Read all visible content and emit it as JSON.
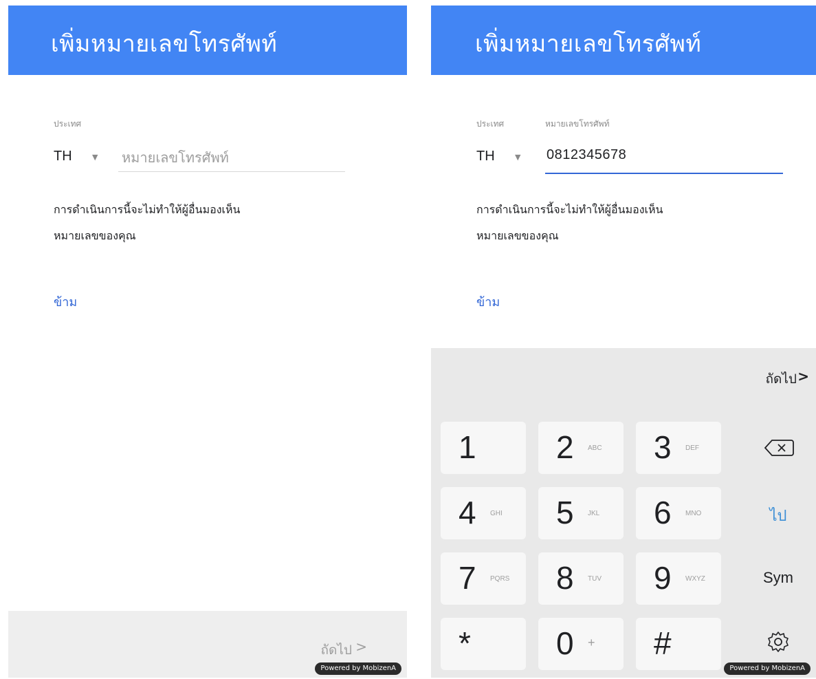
{
  "left_screen": {
    "title": "เพิ่มหมายเลขโทรศัพท์",
    "country_label": "ประเทศ",
    "country_code": "TH",
    "phone_placeholder": "หมายเลขโทรศัพท์",
    "notice_line1": "การดำเนินการนี้จะไม่ทำให้ผู้อื่นมองเห็น",
    "notice_line2": "หมายเลขของคุณ",
    "skip": "ข้าม",
    "next": "ถัดไป",
    "next_chevron": ">",
    "badge": "Powered by MobizenA"
  },
  "right_screen": {
    "title": "เพิ่มหมายเลขโทรศัพท์",
    "country_label": "ประเทศ",
    "phone_label": "หมายเลขโทรศัพท์",
    "country_code": "TH",
    "phone_value": "0812345678",
    "notice_line1": "การดำเนินการนี้จะไม่ทำให้ผู้อื่นมองเห็น",
    "notice_line2": "หมายเลขของคุณ",
    "skip": "ข้าม",
    "badge": "Powered by MobizenA",
    "keyboard": {
      "next": "ถัดไป",
      "next_chevron": ">",
      "rows": [
        [
          {
            "d": "1",
            "s": ""
          },
          {
            "d": "2",
            "s": "ABC"
          },
          {
            "d": "3",
            "s": "DEF"
          }
        ],
        [
          {
            "d": "4",
            "s": "GHI"
          },
          {
            "d": "5",
            "s": "JKL"
          },
          {
            "d": "6",
            "s": "MNO"
          }
        ],
        [
          {
            "d": "7",
            "s": "PQRS"
          },
          {
            "d": "8",
            "s": "TUV"
          },
          {
            "d": "9",
            "s": "WXYZ"
          }
        ],
        [
          {
            "d": "*",
            "s": ""
          },
          {
            "d": "0",
            "s": "+"
          },
          {
            "d": "#",
            "s": ""
          }
        ]
      ],
      "go": "ไป",
      "sym": "Sym",
      "icons": [
        "backspace-icon",
        "gear-icon"
      ]
    }
  },
  "colors": {
    "appbar": "#4285f4",
    "link": "#3367d6",
    "go": "#3d8fd6"
  }
}
